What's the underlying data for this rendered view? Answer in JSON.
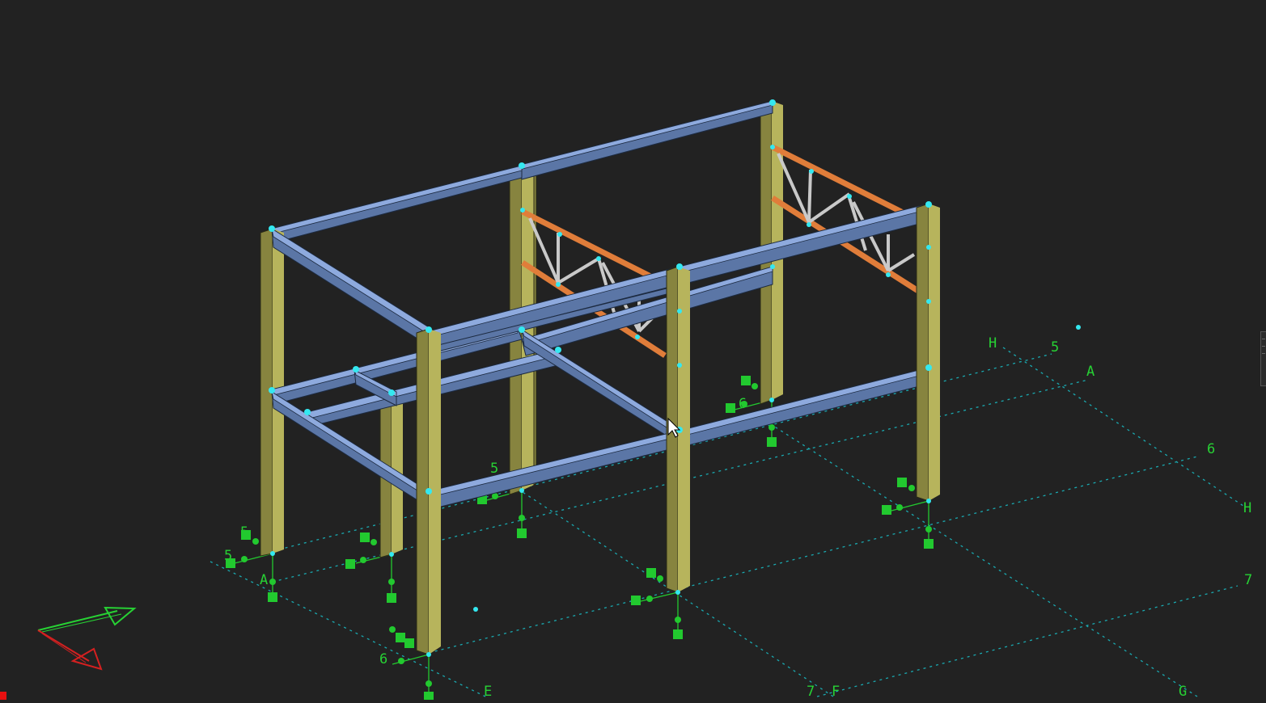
{
  "view": {
    "background": "#222222",
    "model": "steel-frame-3d",
    "colors": {
      "grid": "#1aa9b0",
      "grid_label": "#27d234",
      "column": "#87843f",
      "beam": "#5b76a6",
      "truss_chord": "#e07d3a",
      "truss_web": "#c9c9c9",
      "node": "#34e8f0",
      "support": "#22c92f"
    }
  },
  "grid_labels": {
    "h_top": "H",
    "five_right": "5",
    "a_right": "A",
    "six_right": "6",
    "h_right": "H",
    "seven_right": "7",
    "g_bottom": "G",
    "f_bottom": "F",
    "seven_bottom": "7",
    "e_bottom": "E",
    "six_left": "6",
    "a_left": "A",
    "five_left": "5",
    "five_left2": "5",
    "six_mid": "6",
    "five_mid": "5"
  },
  "axis_triad": {
    "x_color": "#27d234",
    "y_color": "#d42020",
    "icon": "ucs-axis-icon"
  },
  "cursor": {
    "icon": "mouse-pointer-icon"
  },
  "status_marker": {
    "color": "#e81010"
  }
}
